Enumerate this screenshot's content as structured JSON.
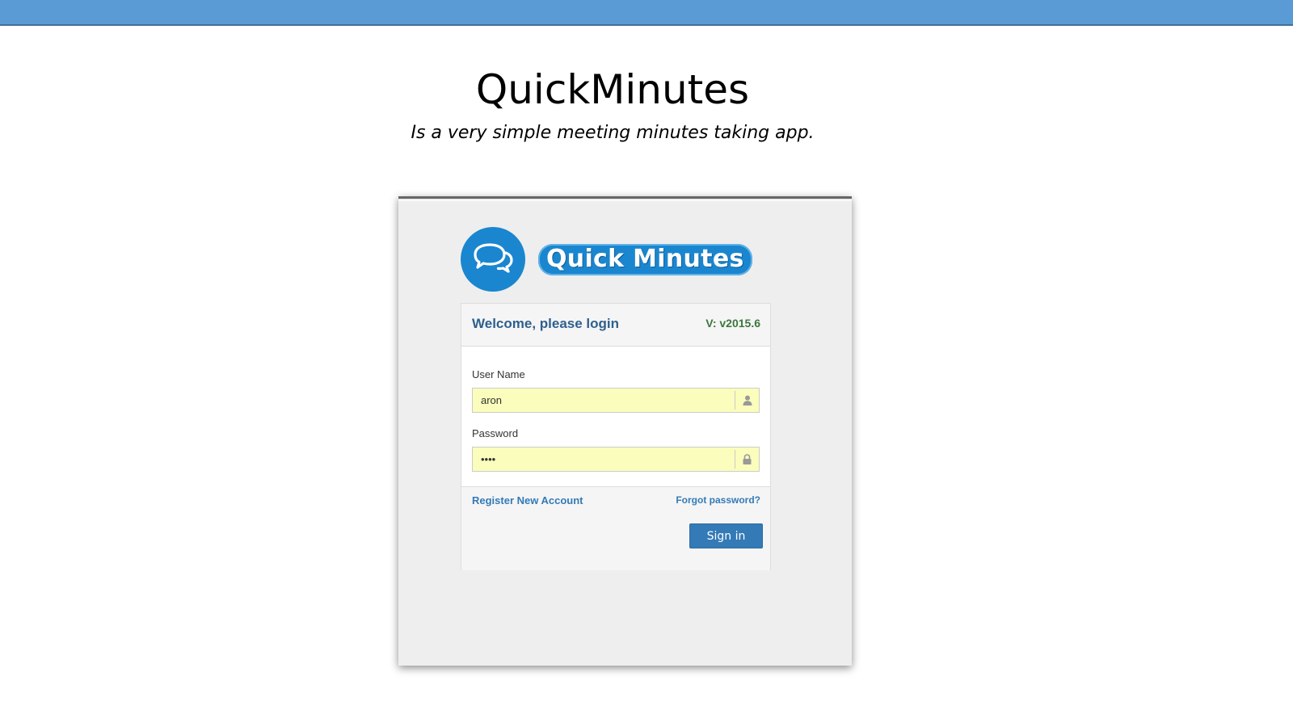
{
  "slide": {
    "title": "QuickMinutes",
    "subtitle": "Is a very simple meeting minutes taking app."
  },
  "logo": {
    "icon": "chat-bubbles-icon",
    "wordmark": "Quick Minutes",
    "color": "#1a86cf"
  },
  "login": {
    "heading": "Welcome, please login",
    "version": "V: v2015.6",
    "username_label": "User Name",
    "username_value": "aron",
    "username_icon": "user-icon",
    "password_label": "Password",
    "password_value": "••••",
    "password_icon": "lock-icon",
    "register_link": "Register New Account",
    "forgot_link": "Forgot password?",
    "signin_label": "Sign in"
  },
  "colors": {
    "top_bar": "#5b9bd5",
    "accent": "#337ab7",
    "input_autofill": "#fafdbb",
    "version_text": "#3c763d"
  }
}
